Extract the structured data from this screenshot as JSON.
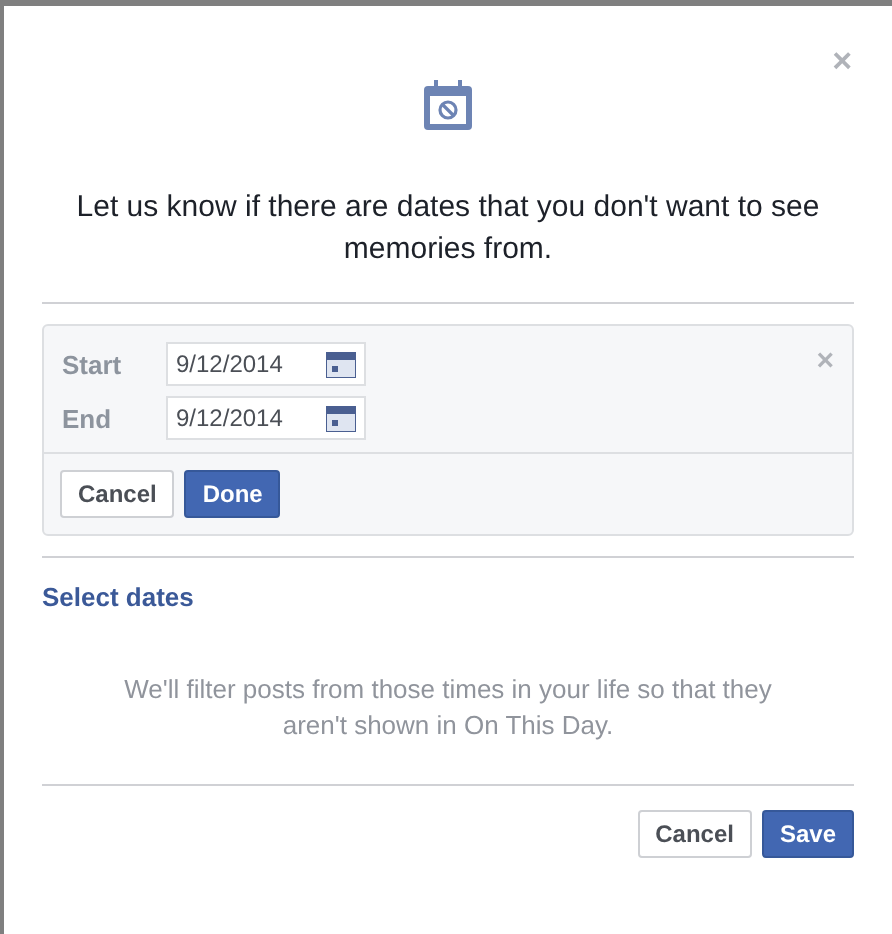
{
  "dialog": {
    "close": "×",
    "message": "Let us know if there are dates that you don't want to see memories from."
  },
  "range": {
    "close": "×",
    "fields": [
      {
        "label": "Start",
        "value": "9/12/2014"
      },
      {
        "label": "End",
        "value": "9/12/2014"
      }
    ],
    "buttons": [
      {
        "label": "Cancel",
        "kind": "secondary"
      },
      {
        "label": "Done",
        "kind": "primary"
      }
    ]
  },
  "section_title": "Select dates",
  "description": "We'll filter posts from those times in your life so that they aren't shown in On This Day.",
  "footer_buttons": [
    {
      "label": "Cancel",
      "kind": "secondary"
    },
    {
      "label": "Save",
      "kind": "primary"
    }
  ]
}
